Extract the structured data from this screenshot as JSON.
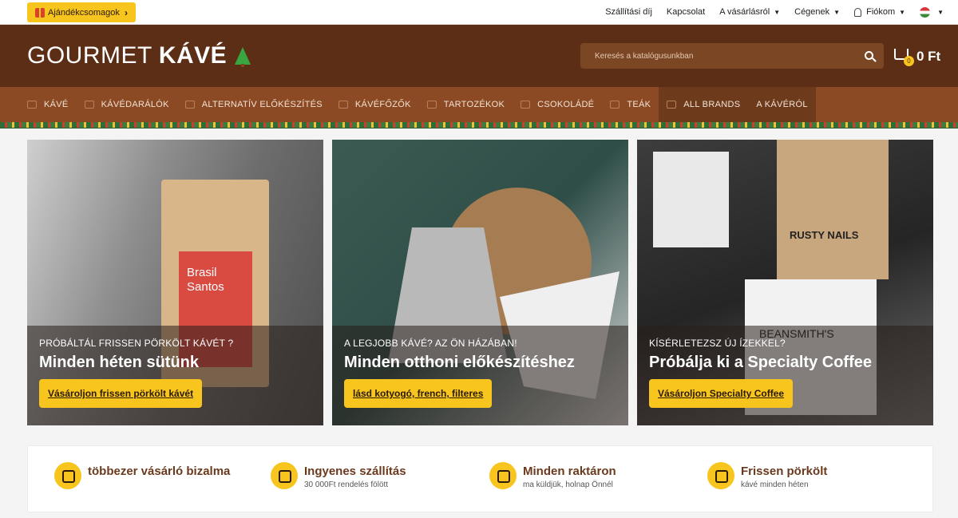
{
  "topbar": {
    "gift_label": "Ajándékcsomagok",
    "links": [
      {
        "label": "Szállítási díj"
      },
      {
        "label": "Kapcsolat"
      },
      {
        "label": "A vásárlásról"
      },
      {
        "label": "Cégenek"
      },
      {
        "label": "Fiókom"
      }
    ]
  },
  "header": {
    "logo_light": "GOURMET",
    "logo_bold": "KÁVÉ",
    "search_placeholder": "Keresés a katalógusunkban",
    "cart_count": "0",
    "cart_total": "0 Ft"
  },
  "nav": {
    "items": [
      {
        "label": "Kávé"
      },
      {
        "label": "Kávédarálók"
      },
      {
        "label": "Alternatív előkészítés"
      },
      {
        "label": "Kávéfőzők"
      },
      {
        "label": "Tartozékok"
      },
      {
        "label": "Csokoládé"
      },
      {
        "label": "Teák"
      },
      {
        "label": "All brands"
      },
      {
        "label": "A kávéról"
      }
    ]
  },
  "hero": [
    {
      "kicker": "Próbáltál frissen pörkölt kávét ?",
      "title": "Minden héten sütünk",
      "cta": "Vásároljon frissen pörkölt kávét",
      "bag_text": "Brasil Santos"
    },
    {
      "kicker": "A legjobb kávé? Az Ön házában!",
      "title": "Minden otthoni előkészítéshez",
      "cta": "lásd kotyogó, french, filteres"
    },
    {
      "kicker": "Kísérletezsz új ízekkel?",
      "title": "Próbálja ki a Specialty Coffee",
      "cta": "Vásároljon Specialty Coffee",
      "brand1": "RUSTY NAILS",
      "brand2": "BEANSMITH'S"
    }
  ],
  "features": [
    {
      "title": "többezer vásárló bizalma",
      "sub": ""
    },
    {
      "title": "Ingyenes szállítás",
      "sub": "30 000Ft rendelés fölött"
    },
    {
      "title": "Minden raktáron",
      "sub": "ma küldjük, holnap Önnél"
    },
    {
      "title": "Frissen pörkölt",
      "sub": "kávé minden héten"
    }
  ],
  "colors": {
    "brand_brown": "#5c2e16",
    "nav_brown": "#8b4a23",
    "accent_yellow": "#f7c51d"
  }
}
